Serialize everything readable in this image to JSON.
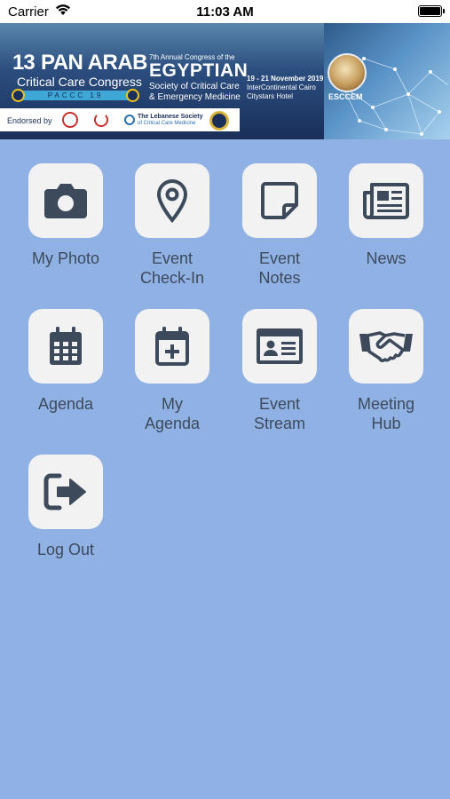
{
  "status_bar": {
    "carrier": "Carrier",
    "time": "11:03 AM"
  },
  "banner": {
    "edition_number": "13",
    "edition_title": "PAN ARAB",
    "congress_name": "Critical Care Congress",
    "short_name": "PACCC 19",
    "annual_line": "7th Annual Congress of the",
    "society_title": "EGYPTIAN",
    "society_line1": "Society of Critical Care",
    "society_line2": "& Emergency Medicine",
    "dates": "19 - 21 November 2019",
    "venue_line1": "InterContinental Cairo",
    "venue_line2": "Citystars Hotel",
    "logo_caption": "ESCCEM",
    "endorsed_label": "Endorsed by",
    "lebanese_line1": "The Lebanese Society",
    "lebanese_line2": "of Critical Care Medicine"
  },
  "menu": [
    {
      "label_lines": [
        "My Photo"
      ],
      "icon": "camera-icon"
    },
    {
      "label_lines": [
        "Event",
        "Check-In"
      ],
      "icon": "map-pin-icon"
    },
    {
      "label_lines": [
        "Event",
        "Notes"
      ],
      "icon": "sticky-note-icon"
    },
    {
      "label_lines": [
        "News"
      ],
      "icon": "newspaper-icon"
    },
    {
      "label_lines": [
        "Agenda"
      ],
      "icon": "calendar-icon"
    },
    {
      "label_lines": [
        "My",
        "Agenda"
      ],
      "icon": "calendar-plus-icon"
    },
    {
      "label_lines": [
        "Event",
        "Stream"
      ],
      "icon": "id-card-icon"
    },
    {
      "label_lines": [
        "Meeting",
        "Hub"
      ],
      "icon": "handshake-icon"
    },
    {
      "label_lines": [
        "Log Out"
      ],
      "icon": "sign-out-icon"
    }
  ],
  "colors": {
    "background": "#8fb1e3",
    "tile": "#f2f2f2",
    "icon": "#3d4a5c",
    "label": "#3d4a5c"
  }
}
